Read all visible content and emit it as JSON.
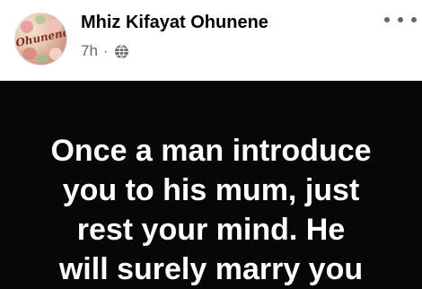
{
  "post": {
    "author": "Mhiz Kifayat Ohunene",
    "time": "7h",
    "separator": "·",
    "privacy_icon": "globe-icon",
    "more_icon": "more-options-icon",
    "avatar_text": "Ohunene"
  },
  "image_text": {
    "lines": [
      "Once a man introduce",
      "you to his mum, just",
      "rest your mind. He",
      "will surely marry you"
    ]
  },
  "colors": {
    "image_background": "#060707",
    "text": "#ffffff",
    "secondary_text": "#65676b"
  }
}
